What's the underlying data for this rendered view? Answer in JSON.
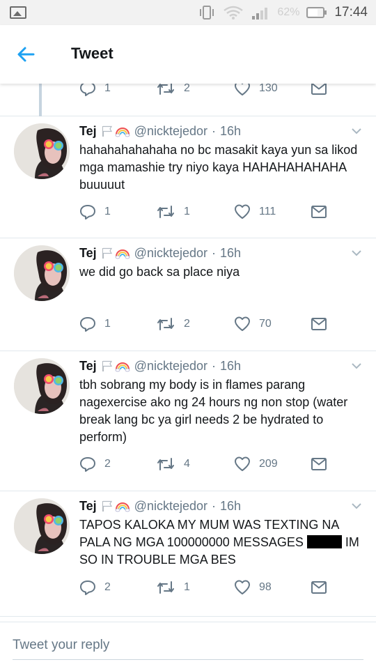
{
  "status_bar": {
    "battery_percent": "62%",
    "time": "17:44"
  },
  "header": {
    "title": "Tweet"
  },
  "top_actions": {
    "replies": "1",
    "retweets": "2",
    "likes": "130"
  },
  "tweets": [
    {
      "name": "Tej",
      "handle": "@nicktejedor",
      "time": "16h",
      "text": "hahahahahahaha no bc masakit kaya yun sa likod mga mamashie try niyo kaya HAHAHAHAHAHA buuuuut",
      "replies": "1",
      "retweets": "1",
      "likes": "111"
    },
    {
      "name": "Tej",
      "handle": "@nicktejedor",
      "time": "16h",
      "text": "we did go back sa place niya",
      "replies": "1",
      "retweets": "2",
      "likes": "70"
    },
    {
      "name": "Tej",
      "handle": "@nicktejedor",
      "time": "16h",
      "text": "tbh sobrang my body is in flames parang nagexercise ako ng 24 hours ng non stop (water break lang bc ya girl needs 2 be hydrated to perform)",
      "replies": "2",
      "retweets": "4",
      "likes": "209"
    },
    {
      "name": "Tej",
      "handle": "@nicktejedor",
      "time": "16h",
      "text_before": "TAPOS KALOKA MY MUM WAS TEXTING NA PALA NG MGA 100000000 MESSAGES",
      "text_after": "IM SO IN TROUBLE MGA BES",
      "replies": "2",
      "retweets": "1",
      "likes": "98"
    }
  ],
  "reply": {
    "placeholder": "Tweet your reply"
  }
}
